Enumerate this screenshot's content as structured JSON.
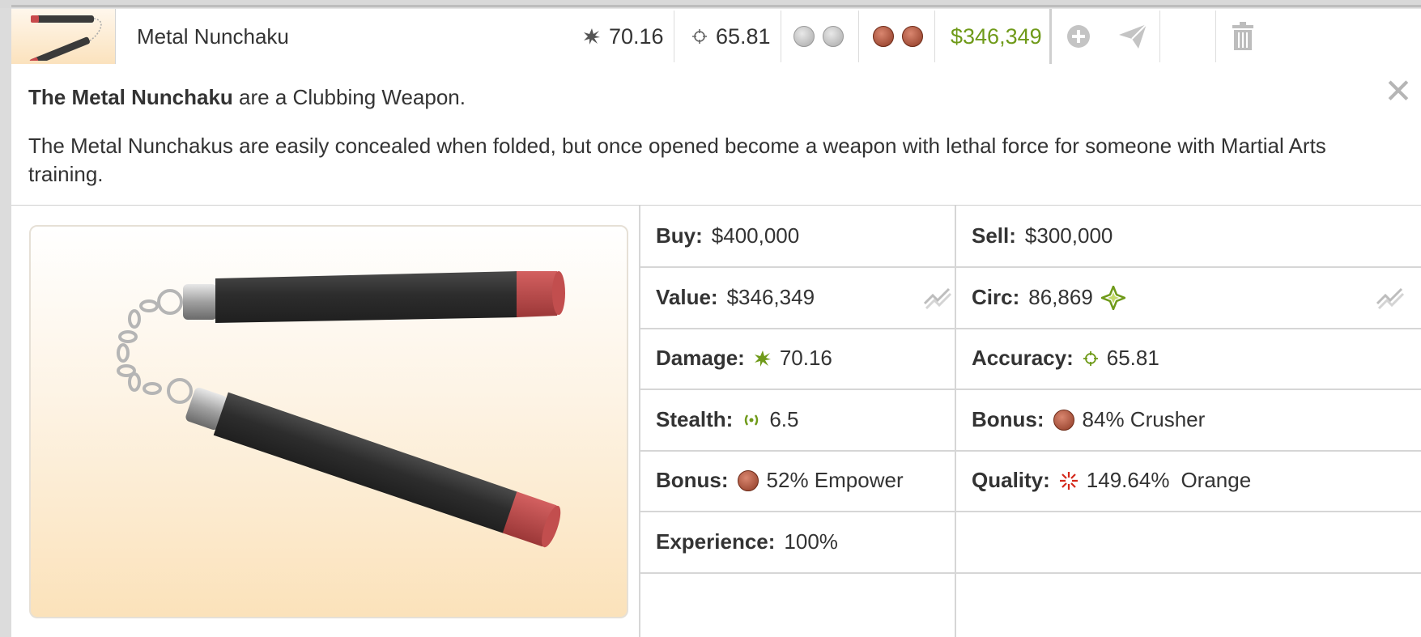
{
  "item": {
    "name": "Metal Nunchaku",
    "damage": "70.16",
    "accuracy": "65.81",
    "price": "$346,349"
  },
  "description": {
    "name_bold": "The Metal Nunchaku",
    "type_text": " are a Clubbing Weapon.",
    "body": "The Metal Nunchakus are easily concealed when folded, but once opened become a weapon with lethal force for someone with Martial Arts training."
  },
  "stats": {
    "buy": {
      "label": "Buy:",
      "value": "$400,000"
    },
    "sell": {
      "label": "Sell:",
      "value": "$300,000"
    },
    "value": {
      "label": "Value:",
      "value": "$346,349"
    },
    "circ": {
      "label": "Circ:",
      "value": "86,869"
    },
    "damage": {
      "label": "Damage:",
      "value": "70.16"
    },
    "accuracy": {
      "label": "Accuracy:",
      "value": "65.81"
    },
    "stealth": {
      "label": "Stealth:",
      "value": "6.5"
    },
    "bonus1": {
      "label": "Bonus:",
      "value": "84% Crusher"
    },
    "bonus2": {
      "label": "Bonus:",
      "value": "52% Empower"
    },
    "quality": {
      "label": "Quality:",
      "value": "149.64%",
      "tier": "Orange"
    },
    "experience": {
      "label": "Experience:",
      "value": "100%"
    }
  },
  "colors": {
    "green": "#6f9a19",
    "quality_red": "#d4281a",
    "quality_orange": "#e47811",
    "bonus_brown": "#8e3a25"
  },
  "icons": {
    "damage": "damage-icon",
    "accuracy": "crosshair-icon",
    "stealth": "stealth-icon",
    "circ": "diamond-star-icon",
    "quality": "quality-burst-icon",
    "add": "add-icon",
    "send": "send-icon",
    "trash": "trash-icon",
    "close": "close-icon",
    "trend": "trend-graph-icon"
  }
}
